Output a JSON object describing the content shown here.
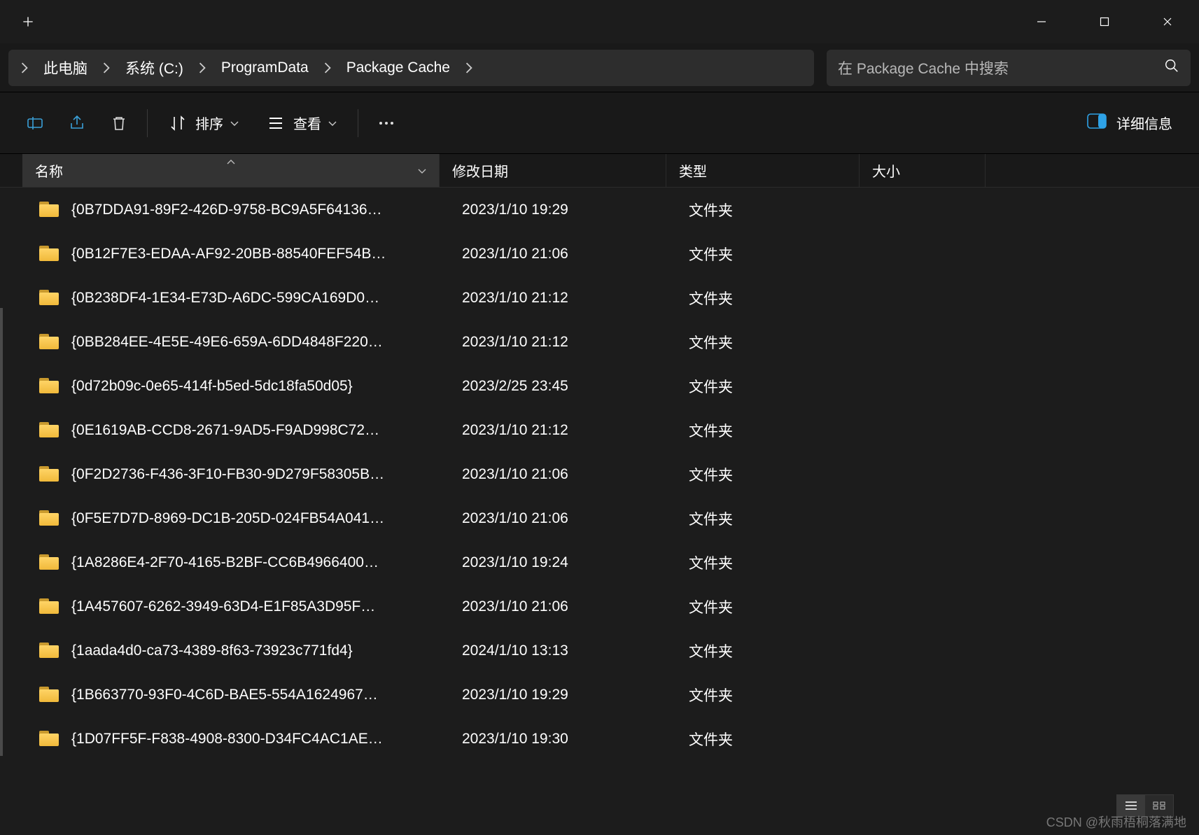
{
  "window": {
    "controls": {
      "min": "min",
      "max": "max",
      "close": "close"
    }
  },
  "breadcrumb": {
    "items": [
      "此电脑",
      "系统 (C:)",
      "ProgramData",
      "Package Cache"
    ]
  },
  "search": {
    "placeholder": "在 Package Cache 中搜索"
  },
  "toolbar": {
    "sort_label": "排序",
    "view_label": "查看",
    "details_label": "详细信息"
  },
  "columns": {
    "name": "名称",
    "date": "修改日期",
    "type": "类型",
    "size": "大小"
  },
  "items": [
    {
      "name": "{0B7DDA91-89F2-426D-9758-BC9A5F64136…",
      "date": "2023/1/10 19:29",
      "type": "文件夹",
      "size": ""
    },
    {
      "name": "{0B12F7E3-EDAA-AF92-20BB-88540FEF54B…",
      "date": "2023/1/10 21:06",
      "type": "文件夹",
      "size": ""
    },
    {
      "name": "{0B238DF4-1E34-E73D-A6DC-599CA169D0…",
      "date": "2023/1/10 21:12",
      "type": "文件夹",
      "size": ""
    },
    {
      "name": "{0BB284EE-4E5E-49E6-659A-6DD4848F220…",
      "date": "2023/1/10 21:12",
      "type": "文件夹",
      "size": ""
    },
    {
      "name": "{0d72b09c-0e65-414f-b5ed-5dc18fa50d05}",
      "date": "2023/2/25 23:45",
      "type": "文件夹",
      "size": ""
    },
    {
      "name": "{0E1619AB-CCD8-2671-9AD5-F9AD998C72…",
      "date": "2023/1/10 21:12",
      "type": "文件夹",
      "size": ""
    },
    {
      "name": "{0F2D2736-F436-3F10-FB30-9D279F58305B…",
      "date": "2023/1/10 21:06",
      "type": "文件夹",
      "size": ""
    },
    {
      "name": "{0F5E7D7D-8969-DC1B-205D-024FB54A041…",
      "date": "2023/1/10 21:06",
      "type": "文件夹",
      "size": ""
    },
    {
      "name": "{1A8286E4-2F70-4165-B2BF-CC6B4966400…",
      "date": "2023/1/10 19:24",
      "type": "文件夹",
      "size": ""
    },
    {
      "name": "{1A457607-6262-3949-63D4-E1F85A3D95F…",
      "date": "2023/1/10 21:06",
      "type": "文件夹",
      "size": ""
    },
    {
      "name": "{1aada4d0-ca73-4389-8f63-73923c771fd4}",
      "date": "2024/1/10 13:13",
      "type": "文件夹",
      "size": ""
    },
    {
      "name": "{1B663770-93F0-4C6D-BAE5-554A1624967…",
      "date": "2023/1/10 19:29",
      "type": "文件夹",
      "size": ""
    },
    {
      "name": "{1D07FF5F-F838-4908-8300-D34FC4AC1AE…",
      "date": "2023/1/10 19:30",
      "type": "文件夹",
      "size": ""
    }
  ],
  "watermark": "CSDN @秋雨梧桐落满地"
}
